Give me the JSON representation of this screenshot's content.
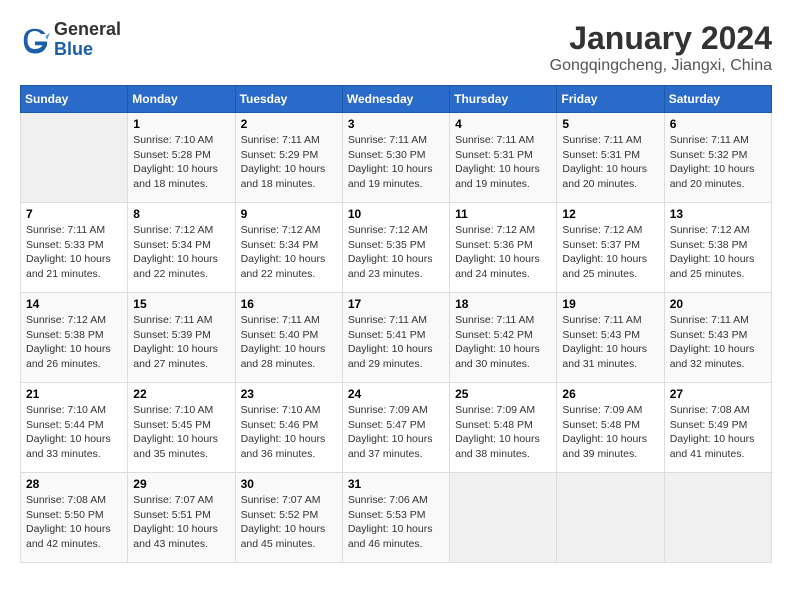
{
  "logo": {
    "general": "General",
    "blue": "Blue"
  },
  "title": "January 2024",
  "location": "Gongqingcheng, Jiangxi, China",
  "columns": [
    "Sunday",
    "Monday",
    "Tuesday",
    "Wednesday",
    "Thursday",
    "Friday",
    "Saturday"
  ],
  "weeks": [
    [
      {
        "day": "",
        "info": ""
      },
      {
        "day": "1",
        "info": "Sunrise: 7:10 AM\nSunset: 5:28 PM\nDaylight: 10 hours\nand 18 minutes."
      },
      {
        "day": "2",
        "info": "Sunrise: 7:11 AM\nSunset: 5:29 PM\nDaylight: 10 hours\nand 18 minutes."
      },
      {
        "day": "3",
        "info": "Sunrise: 7:11 AM\nSunset: 5:30 PM\nDaylight: 10 hours\nand 19 minutes."
      },
      {
        "day": "4",
        "info": "Sunrise: 7:11 AM\nSunset: 5:31 PM\nDaylight: 10 hours\nand 19 minutes."
      },
      {
        "day": "5",
        "info": "Sunrise: 7:11 AM\nSunset: 5:31 PM\nDaylight: 10 hours\nand 20 minutes."
      },
      {
        "day": "6",
        "info": "Sunrise: 7:11 AM\nSunset: 5:32 PM\nDaylight: 10 hours\nand 20 minutes."
      }
    ],
    [
      {
        "day": "7",
        "info": "Sunrise: 7:11 AM\nSunset: 5:33 PM\nDaylight: 10 hours\nand 21 minutes."
      },
      {
        "day": "8",
        "info": "Sunrise: 7:12 AM\nSunset: 5:34 PM\nDaylight: 10 hours\nand 22 minutes."
      },
      {
        "day": "9",
        "info": "Sunrise: 7:12 AM\nSunset: 5:34 PM\nDaylight: 10 hours\nand 22 minutes."
      },
      {
        "day": "10",
        "info": "Sunrise: 7:12 AM\nSunset: 5:35 PM\nDaylight: 10 hours\nand 23 minutes."
      },
      {
        "day": "11",
        "info": "Sunrise: 7:12 AM\nSunset: 5:36 PM\nDaylight: 10 hours\nand 24 minutes."
      },
      {
        "day": "12",
        "info": "Sunrise: 7:12 AM\nSunset: 5:37 PM\nDaylight: 10 hours\nand 25 minutes."
      },
      {
        "day": "13",
        "info": "Sunrise: 7:12 AM\nSunset: 5:38 PM\nDaylight: 10 hours\nand 25 minutes."
      }
    ],
    [
      {
        "day": "14",
        "info": "Sunrise: 7:12 AM\nSunset: 5:38 PM\nDaylight: 10 hours\nand 26 minutes."
      },
      {
        "day": "15",
        "info": "Sunrise: 7:11 AM\nSunset: 5:39 PM\nDaylight: 10 hours\nand 27 minutes."
      },
      {
        "day": "16",
        "info": "Sunrise: 7:11 AM\nSunset: 5:40 PM\nDaylight: 10 hours\nand 28 minutes."
      },
      {
        "day": "17",
        "info": "Sunrise: 7:11 AM\nSunset: 5:41 PM\nDaylight: 10 hours\nand 29 minutes."
      },
      {
        "day": "18",
        "info": "Sunrise: 7:11 AM\nSunset: 5:42 PM\nDaylight: 10 hours\nand 30 minutes."
      },
      {
        "day": "19",
        "info": "Sunrise: 7:11 AM\nSunset: 5:43 PM\nDaylight: 10 hours\nand 31 minutes."
      },
      {
        "day": "20",
        "info": "Sunrise: 7:11 AM\nSunset: 5:43 PM\nDaylight: 10 hours\nand 32 minutes."
      }
    ],
    [
      {
        "day": "21",
        "info": "Sunrise: 7:10 AM\nSunset: 5:44 PM\nDaylight: 10 hours\nand 33 minutes."
      },
      {
        "day": "22",
        "info": "Sunrise: 7:10 AM\nSunset: 5:45 PM\nDaylight: 10 hours\nand 35 minutes."
      },
      {
        "day": "23",
        "info": "Sunrise: 7:10 AM\nSunset: 5:46 PM\nDaylight: 10 hours\nand 36 minutes."
      },
      {
        "day": "24",
        "info": "Sunrise: 7:09 AM\nSunset: 5:47 PM\nDaylight: 10 hours\nand 37 minutes."
      },
      {
        "day": "25",
        "info": "Sunrise: 7:09 AM\nSunset: 5:48 PM\nDaylight: 10 hours\nand 38 minutes."
      },
      {
        "day": "26",
        "info": "Sunrise: 7:09 AM\nSunset: 5:48 PM\nDaylight: 10 hours\nand 39 minutes."
      },
      {
        "day": "27",
        "info": "Sunrise: 7:08 AM\nSunset: 5:49 PM\nDaylight: 10 hours\nand 41 minutes."
      }
    ],
    [
      {
        "day": "28",
        "info": "Sunrise: 7:08 AM\nSunset: 5:50 PM\nDaylight: 10 hours\nand 42 minutes."
      },
      {
        "day": "29",
        "info": "Sunrise: 7:07 AM\nSunset: 5:51 PM\nDaylight: 10 hours\nand 43 minutes."
      },
      {
        "day": "30",
        "info": "Sunrise: 7:07 AM\nSunset: 5:52 PM\nDaylight: 10 hours\nand 45 minutes."
      },
      {
        "day": "31",
        "info": "Sunrise: 7:06 AM\nSunset: 5:53 PM\nDaylight: 10 hours\nand 46 minutes."
      },
      {
        "day": "",
        "info": ""
      },
      {
        "day": "",
        "info": ""
      },
      {
        "day": "",
        "info": ""
      }
    ]
  ]
}
